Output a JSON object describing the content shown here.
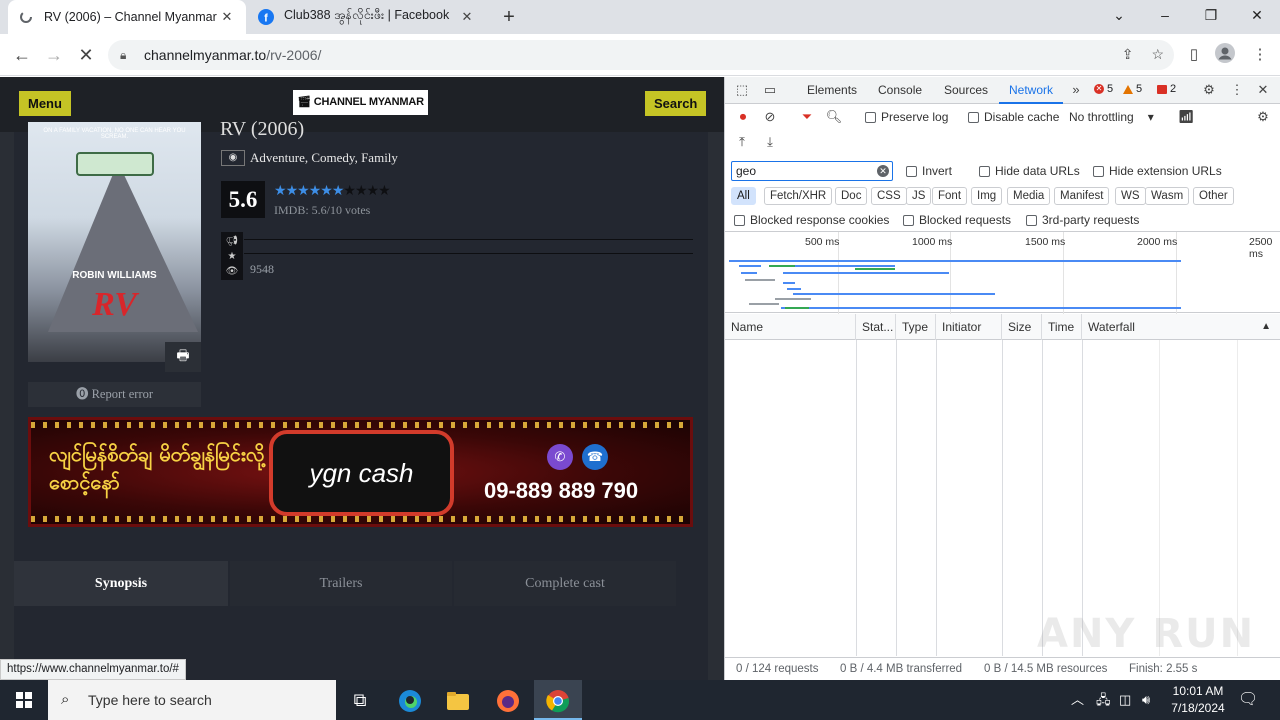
{
  "browser": {
    "tabs": [
      {
        "title": "RV (2006) – Channel Myanmar",
        "active": true
      },
      {
        "title": "Club388 အွန်လိုင်းဖီး | Facebook",
        "active": false
      }
    ],
    "new_tab_icon": "+",
    "address": {
      "host": "channelmyanmar.to",
      "path": "/rv-2006/"
    },
    "status_url": "https://www.channelmyanmar.to/#"
  },
  "site": {
    "menu_label": "Menu",
    "search_label": "Search",
    "logo_text": "CHANNEL MYANMAR",
    "movie_title": "RV (2006)",
    "genres": "Adventure, Comedy, Family",
    "rating": "5.6",
    "stars_filled": 5.5,
    "stars_total": 10,
    "imdb_text": "IMDB: 5.6/10  votes",
    "views": "9548",
    "report_label": "Report error",
    "poster": {
      "tagline": "ON A FAMILY VACATION, NO ONE CAN HEAR YOU SCREAM.",
      "actor": "ROBIN WILLIAMS",
      "logo": "RV"
    },
    "banner": {
      "myanmar_text": "လျင်မြန်စိတ်ချ မိတ်ချွန်မြင်းလို့ စောင့်နော်",
      "brand": "ygn cash",
      "phone": "09-889 889 790"
    },
    "tabs": [
      "Synopsis",
      "Trailers",
      "Complete cast"
    ]
  },
  "devtools": {
    "tabs": [
      "Elements",
      "Console",
      "Sources",
      "Network"
    ],
    "active_tab": "Network",
    "errors": "5",
    "warnings": "5",
    "issues": "2",
    "preserve_log": "Preserve log",
    "disable_cache": "Disable cache",
    "throttling": "No throttling",
    "filter_value": "geo",
    "invert": "Invert",
    "hide_data_urls": "Hide data URLs",
    "hide_extension_urls": "Hide extension URLs",
    "type_filters": [
      "All",
      "Fetch/XHR",
      "Doc",
      "CSS",
      "JS",
      "Font",
      "Img",
      "Media",
      "Manifest",
      "WS",
      "Wasm",
      "Other"
    ],
    "blocked_cookies": "Blocked response cookies",
    "blocked_requests": "Blocked requests",
    "third_party": "3rd-party requests",
    "timeline_labels": [
      "500 ms",
      "1000 ms",
      "1500 ms",
      "2000 ms",
      "2500 ms"
    ],
    "columns": [
      "Name",
      "Stat...",
      "Type",
      "Initiator",
      "Size",
      "Time",
      "Waterfall"
    ],
    "status": {
      "requests": "0 / 124 requests",
      "transferred": "0 B / 4.4 MB transferred",
      "resources": "0 B / 14.5 MB resources",
      "finish": "Finish: 2.55 s"
    },
    "watermark": "ANY RUN"
  },
  "taskbar": {
    "search_placeholder": "Type here to search",
    "time": "10:01 AM",
    "date": "7/18/2024"
  },
  "colors": {
    "site_bg": "#2a2e35",
    "accent_yellow": "#c5c425",
    "star_blue": "#3d8ee6",
    "devtools_blue": "#1a73e8"
  }
}
